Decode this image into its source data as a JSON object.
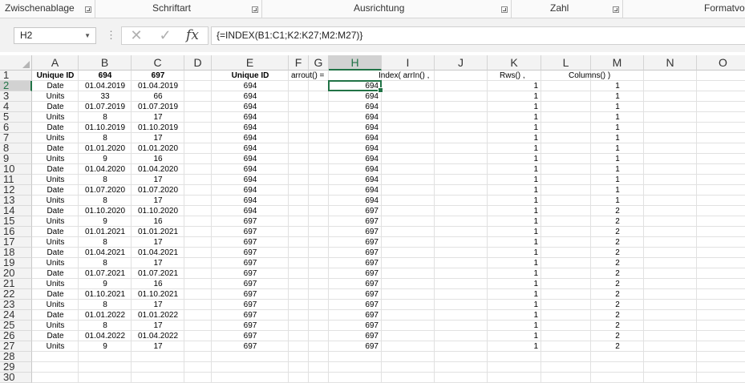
{
  "ribbon": {
    "groups": [
      "Zwischenablage",
      "Schriftart",
      "Ausrichtung",
      "Zahl",
      "Formatvo"
    ]
  },
  "formula_bar": {
    "name_box": "H2",
    "cancel_icon": "x-icon",
    "enter_icon": "check-icon",
    "fx_label": "fx",
    "formula": "{=INDEX(B1:C1;K2:K27;M2:M27)}"
  },
  "columns": [
    "A",
    "B",
    "C",
    "D",
    "E",
    "F",
    "G",
    "H",
    "I",
    "J",
    "K",
    "L",
    "M",
    "N",
    "O"
  ],
  "selected_column": "H",
  "selected_row": 2,
  "row_numbers": [
    1,
    2,
    3,
    4,
    5,
    6,
    7,
    8,
    9,
    10,
    11,
    12,
    13,
    14,
    15,
    16,
    17,
    18,
    19,
    20,
    21,
    22,
    23,
    24,
    25,
    26,
    27,
    28,
    29,
    30
  ],
  "header_row": {
    "A": "Unique ID",
    "B": "694",
    "C": "697",
    "E": "Unique ID",
    "F": "arrout()  =",
    "I": "Index( arrIn() ,",
    "K": "Rws() ,",
    "M": "Columns() )"
  },
  "rows": [
    {
      "A": "Date",
      "B": "01.04.2019",
      "C": "01.04.2019",
      "E": "694",
      "H": "694",
      "K": "1",
      "M": "1"
    },
    {
      "A": "Units",
      "B": "33",
      "C": "66",
      "E": "694",
      "H": "694",
      "K": "1",
      "M": "1"
    },
    {
      "A": "Date",
      "B": "01.07.2019",
      "C": "01.07.2019",
      "E": "694",
      "H": "694",
      "K": "1",
      "M": "1"
    },
    {
      "A": "Units",
      "B": "8",
      "C": "17",
      "E": "694",
      "H": "694",
      "K": "1",
      "M": "1"
    },
    {
      "A": "Date",
      "B": "01.10.2019",
      "C": "01.10.2019",
      "E": "694",
      "H": "694",
      "K": "1",
      "M": "1"
    },
    {
      "A": "Units",
      "B": "8",
      "C": "17",
      "E": "694",
      "H": "694",
      "K": "1",
      "M": "1"
    },
    {
      "A": "Date",
      "B": "01.01.2020",
      "C": "01.01.2020",
      "E": "694",
      "H": "694",
      "K": "1",
      "M": "1"
    },
    {
      "A": "Units",
      "B": "9",
      "C": "16",
      "E": "694",
      "H": "694",
      "K": "1",
      "M": "1"
    },
    {
      "A": "Date",
      "B": "01.04.2020",
      "C": "01.04.2020",
      "E": "694",
      "H": "694",
      "K": "1",
      "M": "1"
    },
    {
      "A": "Units",
      "B": "8",
      "C": "17",
      "E": "694",
      "H": "694",
      "K": "1",
      "M": "1"
    },
    {
      "A": "Date",
      "B": "01.07.2020",
      "C": "01.07.2020",
      "E": "694",
      "H": "694",
      "K": "1",
      "M": "1"
    },
    {
      "A": "Units",
      "B": "8",
      "C": "17",
      "E": "694",
      "H": "694",
      "K": "1",
      "M": "1"
    },
    {
      "A": "Date",
      "B": "01.10.2020",
      "C": "01.10.2020",
      "E": "694",
      "H": "697",
      "K": "1",
      "M": "2"
    },
    {
      "A": "Units",
      "B": "9",
      "C": "16",
      "E": "697",
      "H": "697",
      "K": "1",
      "M": "2"
    },
    {
      "A": "Date",
      "B": "01.01.2021",
      "C": "01.01.2021",
      "E": "697",
      "H": "697",
      "K": "1",
      "M": "2"
    },
    {
      "A": "Units",
      "B": "8",
      "C": "17",
      "E": "697",
      "H": "697",
      "K": "1",
      "M": "2"
    },
    {
      "A": "Date",
      "B": "01.04.2021",
      "C": "01.04.2021",
      "E": "697",
      "H": "697",
      "K": "1",
      "M": "2"
    },
    {
      "A": "Units",
      "B": "8",
      "C": "17",
      "E": "697",
      "H": "697",
      "K": "1",
      "M": "2"
    },
    {
      "A": "Date",
      "B": "01.07.2021",
      "C": "01.07.2021",
      "E": "697",
      "H": "697",
      "K": "1",
      "M": "2"
    },
    {
      "A": "Units",
      "B": "9",
      "C": "16",
      "E": "697",
      "H": "697",
      "K": "1",
      "M": "2"
    },
    {
      "A": "Date",
      "B": "01.10.2021",
      "C": "01.10.2021",
      "E": "697",
      "H": "697",
      "K": "1",
      "M": "2"
    },
    {
      "A": "Units",
      "B": "8",
      "C": "17",
      "E": "697",
      "H": "697",
      "K": "1",
      "M": "2"
    },
    {
      "A": "Date",
      "B": "01.01.2022",
      "C": "01.01.2022",
      "E": "697",
      "H": "697",
      "K": "1",
      "M": "2"
    },
    {
      "A": "Units",
      "B": "8",
      "C": "17",
      "E": "697",
      "H": "697",
      "K": "1",
      "M": "2"
    },
    {
      "A": "Date",
      "B": "01.04.2022",
      "C": "01.04.2022",
      "E": "697",
      "H": "697",
      "K": "1",
      "M": "2"
    },
    {
      "A": "Units",
      "B": "9",
      "C": "17",
      "E": "697",
      "H": "697",
      "K": "1",
      "M": "2"
    }
  ],
  "colors": {
    "accent": "#217346"
  }
}
